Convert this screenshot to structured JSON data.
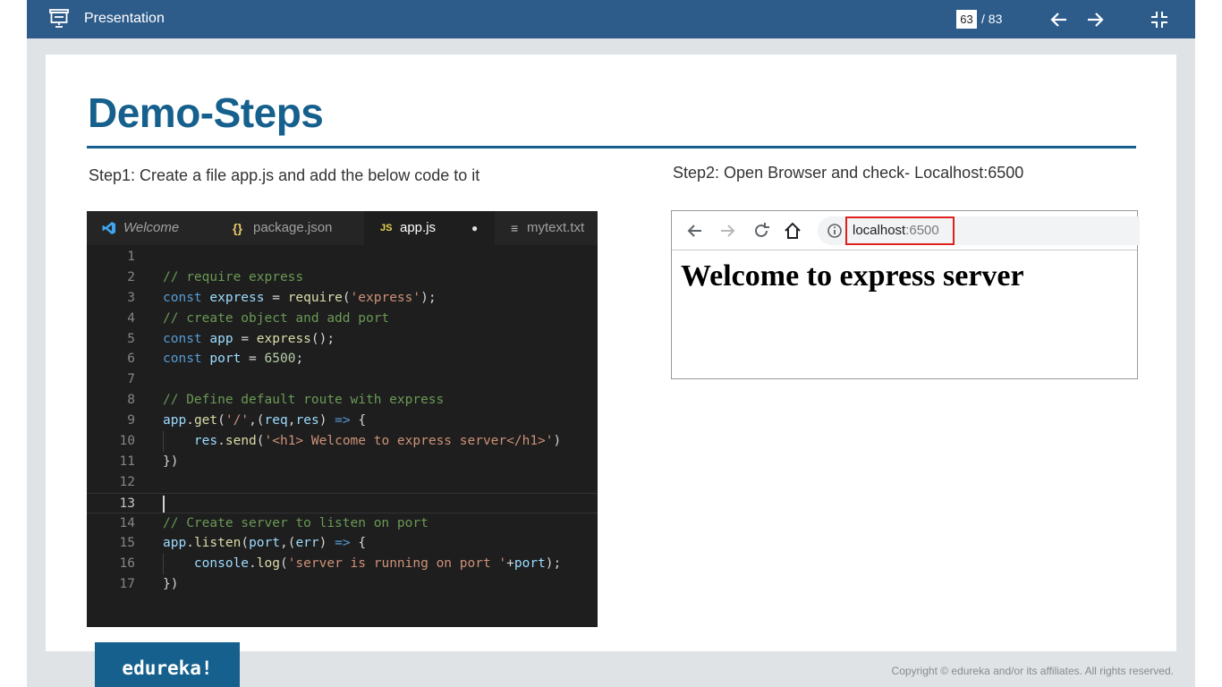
{
  "topbar": {
    "title": "Presentation",
    "current_page": "63",
    "total_pages": "/ 83",
    "icons": [
      "presentation-icon",
      "arrow-left-icon",
      "arrow-right-icon",
      "exit-fullscreen-icon"
    ],
    "color": "#2e5c8a"
  },
  "slide": {
    "heading": "Demo-Steps",
    "step1": "Step1: Create a file app.js and add the below code to it",
    "step2": "Step2: Open Browser and check- Localhost:6500",
    "accent": "#16608d"
  },
  "editor": {
    "tabs": [
      {
        "label": "Welcome",
        "icon": "vscode-icon"
      },
      {
        "label": "package.json",
        "icon": "{}"
      },
      {
        "label": "app.js",
        "icon": "JS"
      },
      {
        "label": "mytext.txt",
        "icon": "≡"
      }
    ],
    "modified_dot": "●",
    "line_numbers": [
      "1",
      "2",
      "3",
      "4",
      "5",
      "6",
      "7",
      "8",
      "9",
      "10",
      "11",
      "12",
      "13",
      "14",
      "15",
      "16",
      "17"
    ]
  },
  "browser": {
    "url_host": "localhost",
    "url_port": ":6500",
    "page_heading": "Welcome to express server"
  },
  "footer": {
    "logo": "edureka!",
    "copyright": "Copyright © edureka and/or its affiliates. All rights reserved."
  }
}
